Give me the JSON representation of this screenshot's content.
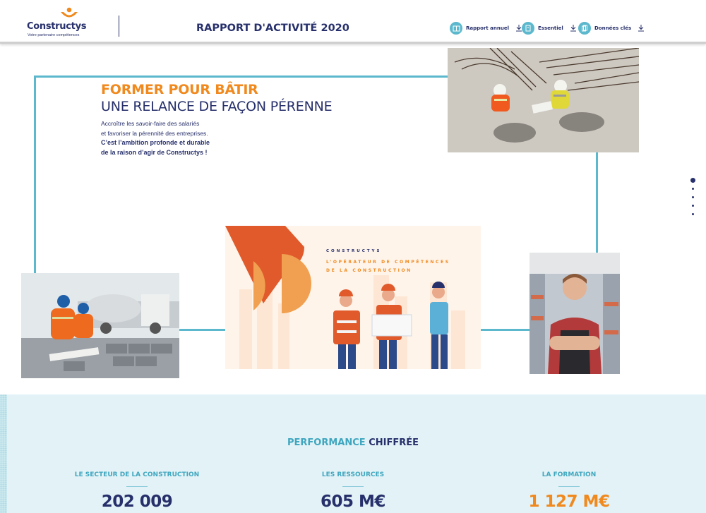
{
  "brand": {
    "name": "Constructys",
    "tagline": "Votre partenaire compétences"
  },
  "header": {
    "title": "RAPPORT D'ACTIVITÉ 2020",
    "downloads": [
      {
        "label": "Rapport annuel",
        "icon": "book-icon"
      },
      {
        "label": "Essentiel",
        "icon": "document-icon"
      },
      {
        "label": "Données clés",
        "icon": "pages-icon"
      }
    ]
  },
  "hero": {
    "kicker": "FORMER POUR BÂTIR",
    "title": "UNE RELANCE DE FAÇON PÉRENNE",
    "lines": [
      "Accroître les savoir-faire des salariés",
      "et favoriser la pérennité des entreprises."
    ],
    "bold_lines": [
      "C’est l’ambition profonde et durable",
      "de la raison d’agir de Constructys !"
    ]
  },
  "illustration": {
    "brand": "CONSTRUCTYS",
    "subtitle_lines": [
      "L’OPÉRATEUR DE COMPÉTENCES",
      "DE LA CONSTRUCTION"
    ]
  },
  "pager": {
    "count": 5,
    "active": 0
  },
  "performance": {
    "title_a": "PERFORMANCE",
    "title_b": "CHIFFRÉE",
    "stats": [
      {
        "label": "LE SECTEUR DE LA CONSTRUCTION",
        "value": "202 009"
      },
      {
        "label": "LES RESSOURCES",
        "value": "605 M€"
      },
      {
        "label": "LA FORMATION",
        "value": "1 127 M€"
      }
    ]
  },
  "colors": {
    "navy": "#27306b",
    "orange": "#f0891e",
    "teal": "#5cb8cd",
    "pale_teal": "#e2f2f6"
  }
}
